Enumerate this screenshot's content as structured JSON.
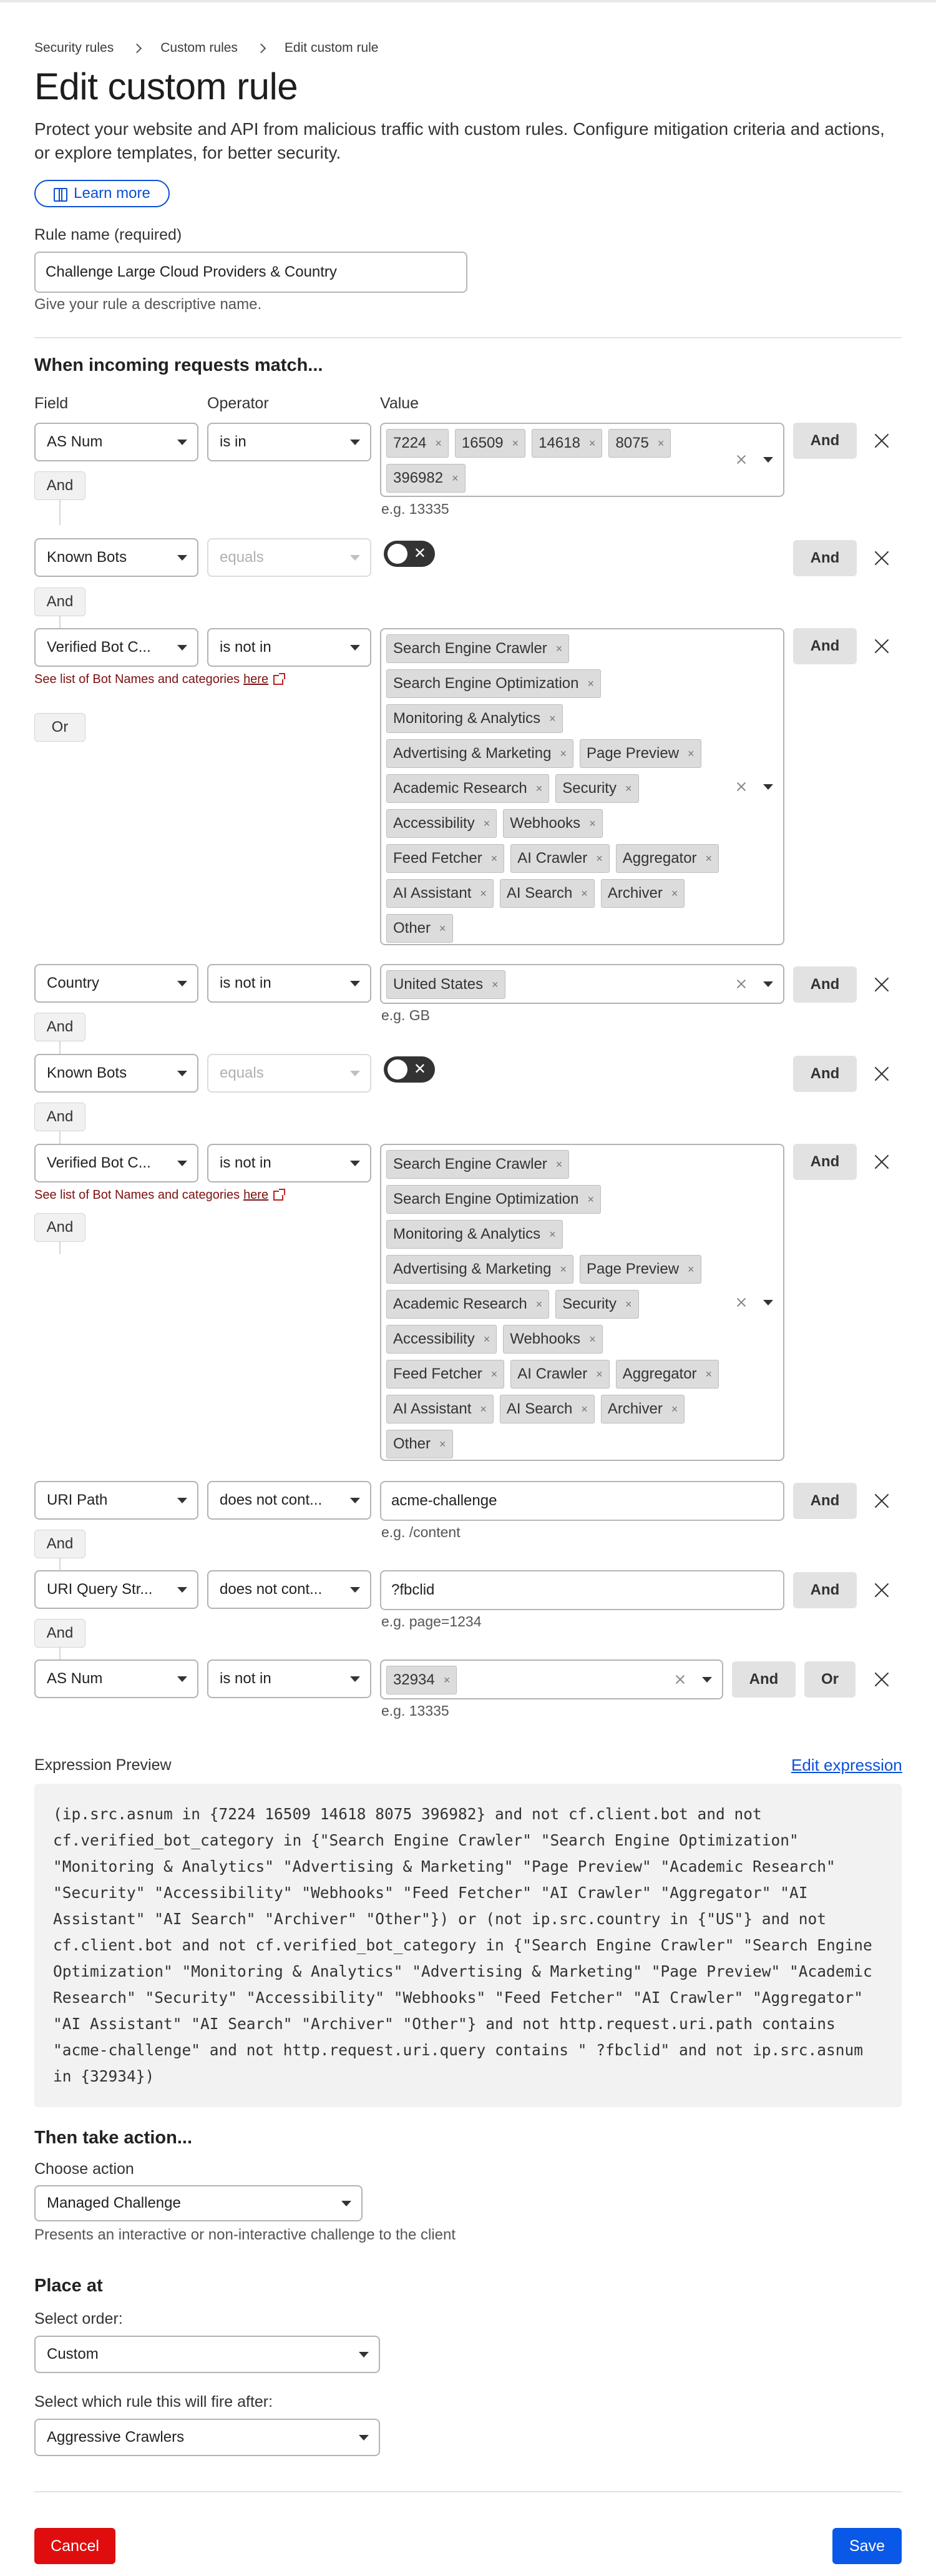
{
  "breadcrumb": [
    "Security rules",
    "Custom rules",
    "Edit custom rule"
  ],
  "title": "Edit custom rule",
  "description": "Protect your website and API from malicious traffic with custom rules. Configure mitigation criteria and actions, or explore templates, for better security.",
  "learn_more": "Learn more",
  "rule_name": {
    "label": "Rule name (required)",
    "value": "Challenge Large Cloud Providers & Country",
    "help": "Give your rule a descriptive name."
  },
  "match": {
    "heading": "When incoming requests match...",
    "col_field": "Field",
    "col_operator": "Operator",
    "col_value": "Value",
    "and_label": "And",
    "or_label": "Or",
    "bot_link_text": "See list of Bot Names and categories",
    "bot_link_here": "here",
    "rows": [
      {
        "field": "AS Num",
        "operator": "is in",
        "chips": [
          "7224",
          "16509",
          "14618",
          "8075",
          "396982"
        ],
        "example": "e.g. 13335"
      },
      {
        "field": "Known Bots",
        "operator": "equals"
      },
      {
        "field": "Verified Bot C...",
        "operator": "is not in",
        "chips": [
          "Search Engine Crawler",
          "Search Engine Optimization",
          "Monitoring & Analytics",
          "Advertising & Marketing",
          "Page Preview",
          "Academic Research",
          "Security",
          "Accessibility",
          "Webhooks",
          "Feed Fetcher",
          "AI Crawler",
          "Aggregator",
          "AI Assistant",
          "AI Search",
          "Archiver",
          "Other"
        ]
      },
      {
        "field": "Country",
        "operator": "is not in",
        "chips": [
          "United States"
        ],
        "example": "e.g. GB"
      },
      {
        "field": "Known Bots",
        "operator": "equals"
      },
      {
        "field": "Verified Bot C...",
        "operator": "is not in",
        "chips": [
          "Search Engine Crawler",
          "Search Engine Optimization",
          "Monitoring & Analytics",
          "Advertising & Marketing",
          "Page Preview",
          "Academic Research",
          "Security",
          "Accessibility",
          "Webhooks",
          "Feed Fetcher",
          "AI Crawler",
          "Aggregator",
          "AI Assistant",
          "AI Search",
          "Archiver",
          "Other"
        ]
      },
      {
        "field": "URI Path",
        "operator": "does not cont...",
        "value": "acme-challenge",
        "example": "e.g. /content"
      },
      {
        "field": "URI Query Str...",
        "operator": "does not cont...",
        "value": "?fbclid",
        "example": "e.g. page=1234"
      },
      {
        "field": "AS Num",
        "operator": "is not in",
        "chips": [
          "32934"
        ],
        "example": "e.g. 13335"
      }
    ]
  },
  "expression": {
    "label": "Expression Preview",
    "edit": "Edit expression",
    "code": "(ip.src.asnum in {7224 16509 14618 8075 396982} and not cf.client.bot and not cf.verified_bot_category in {\"Search Engine Crawler\" \"Search Engine Optimization\" \"Monitoring & Analytics\" \"Advertising & Marketing\" \"Page Preview\" \"Academic Research\" \"Security\" \"Accessibility\" \"Webhooks\" \"Feed Fetcher\" \"AI Crawler\" \"Aggregator\" \"AI Assistant\" \"AI Search\" \"Archiver\" \"Other\"}) or (not ip.src.country in {\"US\"} and not cf.client.bot and not cf.verified_bot_category in {\"Search Engine Crawler\" \"Search Engine Optimization\" \"Monitoring & Analytics\" \"Advertising & Marketing\" \"Page Preview\" \"Academic Research\" \"Security\" \"Accessibility\" \"Webhooks\" \"Feed Fetcher\" \"AI Crawler\" \"Aggregator\" \"AI Assistant\" \"AI Search\" \"Archiver\" \"Other\"} and not http.request.uri.path contains \"acme-challenge\" and not http.request.uri.query contains \" ?fbclid\" and not ip.src.asnum in {32934})"
  },
  "action": {
    "heading": "Then take action...",
    "label": "Choose action",
    "value": "Managed Challenge",
    "help": "Presents an interactive or non-interactive challenge to the client"
  },
  "place": {
    "heading": "Place at",
    "order_label": "Select order:",
    "order_value": "Custom",
    "after_label": "Select which rule this will fire after:",
    "after_value": "Aggressive Crawlers"
  },
  "footer": {
    "cancel": "Cancel",
    "save": "Save"
  },
  "colors": {
    "primary": "#0a58e8",
    "danger": "#df0d0d",
    "link": "#0b4fd8",
    "bot_link": "#7d1010"
  }
}
